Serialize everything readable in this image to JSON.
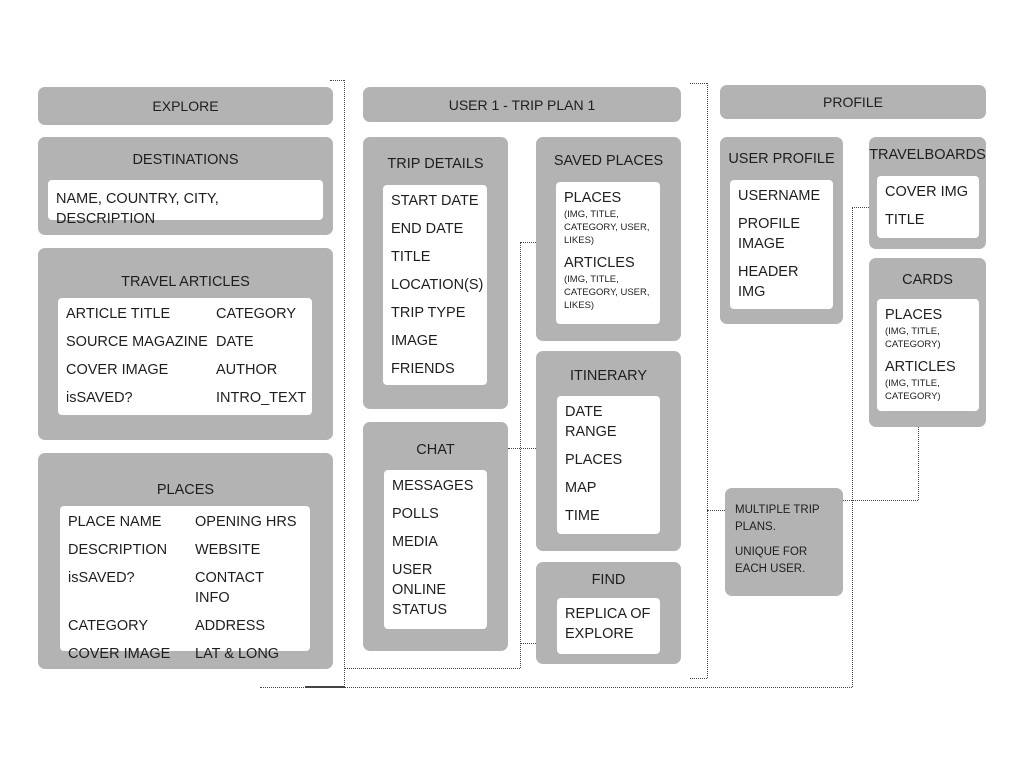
{
  "explore": {
    "header": "EXPLORE",
    "destinations": {
      "title": "DESTINATIONS",
      "items": [
        "NAME, COUNTRY, CITY, DESCRIPTION"
      ]
    },
    "travel_articles": {
      "title": "TRAVEL ARTICLES",
      "items": [
        "ARTICLE TITLE",
        "CATEGORY",
        "SOURCE MAGAZINE",
        "DATE",
        "COVER IMAGE",
        "AUTHOR",
        "isSAVED?",
        "INTRO_TEXT"
      ]
    },
    "places": {
      "title": "PLACES",
      "items": [
        "PLACE NAME",
        "OPENING HRS",
        "DESCRIPTION",
        "WEBSITE",
        "isSAVED?",
        "CONTACT INFO",
        "CATEGORY",
        "ADDRESS",
        "COVER IMAGE",
        "LAT & LONG"
      ]
    }
  },
  "trip_plan": {
    "header": "USER 1 - TRIP PLAN 1",
    "trip_details": {
      "title": "TRIP DETAILS",
      "items": [
        "START DATE",
        "END DATE",
        "TITLE",
        "LOCATION(S)",
        "TRIP TYPE",
        "IMAGE",
        "FRIENDS"
      ]
    },
    "saved_places": {
      "title": "SAVED PLACES",
      "items": [
        {
          "label": "PLACES",
          "sub": "(IMG, TITLE, CATEGORY, USER, LIKES)"
        },
        {
          "label": "ARTICLES",
          "sub": "(IMG, TITLE, CATEGORY, USER, LIKES)"
        }
      ]
    },
    "itinerary": {
      "title": "ITINERARY",
      "items": [
        "DATE RANGE",
        "PLACES",
        "MAP",
        "TIME"
      ]
    },
    "chat": {
      "title": "CHAT",
      "items": [
        "MESSAGES",
        "POLLS",
        "MEDIA",
        "USER ONLINE STATUS"
      ]
    },
    "find": {
      "title": "FIND",
      "items": [
        "REPLICA OF EXPLORE"
      ]
    }
  },
  "profile": {
    "header": "PROFILE",
    "user_profile": {
      "title": "USER PROFILE",
      "items": [
        "USERNAME",
        "PROFILE IMAGE",
        "HEADER IMG"
      ]
    },
    "travelboards": {
      "title": "TRAVELBOARDS",
      "items": [
        "COVER IMG",
        "TITLE"
      ]
    },
    "cards": {
      "title": "CARDS",
      "items": [
        {
          "label": "PLACES",
          "sub": "(IMG, TITLE, CATEGORY)"
        },
        {
          "label": "ARTICLES",
          "sub": "(IMG, TITLE, CATEGORY)"
        }
      ]
    },
    "note": [
      "MULTIPLE TRIP PLANS.",
      "UNIQUE FOR EACH USER."
    ]
  },
  "colors": {
    "box": "#b3b3b3",
    "inner": "#ffffff",
    "text": "#1e1e1e",
    "connector": "#444444"
  }
}
